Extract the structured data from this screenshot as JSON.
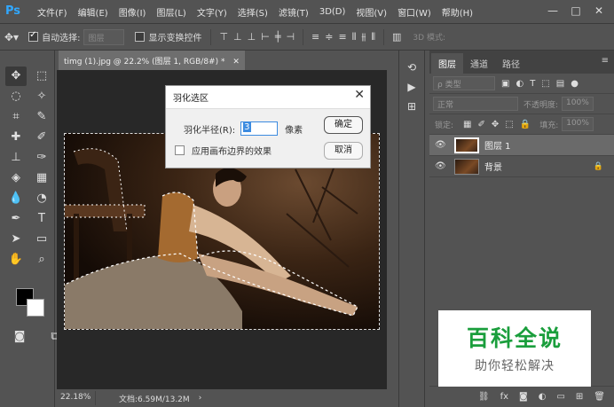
{
  "app": {
    "logo": "Ps"
  },
  "menu": [
    "文件(F)",
    "编辑(E)",
    "图像(I)",
    "图层(L)",
    "文字(Y)",
    "选择(S)",
    "滤镜(T)",
    "3D(D)",
    "视图(V)",
    "窗口(W)",
    "帮助(H)"
  ],
  "window_controls": [
    "—",
    "□",
    "✕"
  ],
  "options": {
    "auto_select_label": "自动选择:",
    "auto_select_checked": true,
    "auto_select_value": "图层",
    "show_transform_label": "显示变换控件",
    "mode3d_label": "3D 模式:"
  },
  "document": {
    "tab_title": "timg (1).jpg @ 22.2% (图层 1, RGB/8#) *",
    "zoom": "22.18%",
    "doc_size": "文档:6.59M/13.2M",
    "status_arrow": "›"
  },
  "dialog": {
    "title": "羽化选区",
    "radius_label": "羽化半径(R):",
    "radius_value": "3",
    "radius_unit": "像素",
    "apply_canvas_label": "应用画布边界的效果",
    "apply_canvas_checked": false,
    "ok_label": "确定",
    "cancel_label": "取消",
    "close": "✕"
  },
  "layers_panel": {
    "tabs": [
      "图层",
      "通道",
      "路径"
    ],
    "menu_glyph": "≡",
    "filter_kind": "ρ 类型",
    "blend_mode": "正常",
    "opacity_label": "不透明度:",
    "opacity_value": "100%",
    "lock_label": "锁定:",
    "fill_label": "填充:",
    "fill_value": "100%",
    "layers": [
      {
        "name": "图层 1",
        "selected": true,
        "locked": false
      },
      {
        "name": "背景",
        "selected": false,
        "locked": true
      }
    ]
  },
  "watermark": {
    "title": "百科全说",
    "subtitle": "助你轻松解决"
  },
  "colors": {
    "ps_blue": "#31a8ff",
    "brand_green": "#1a9e3c",
    "ui_gray": "#535353"
  }
}
